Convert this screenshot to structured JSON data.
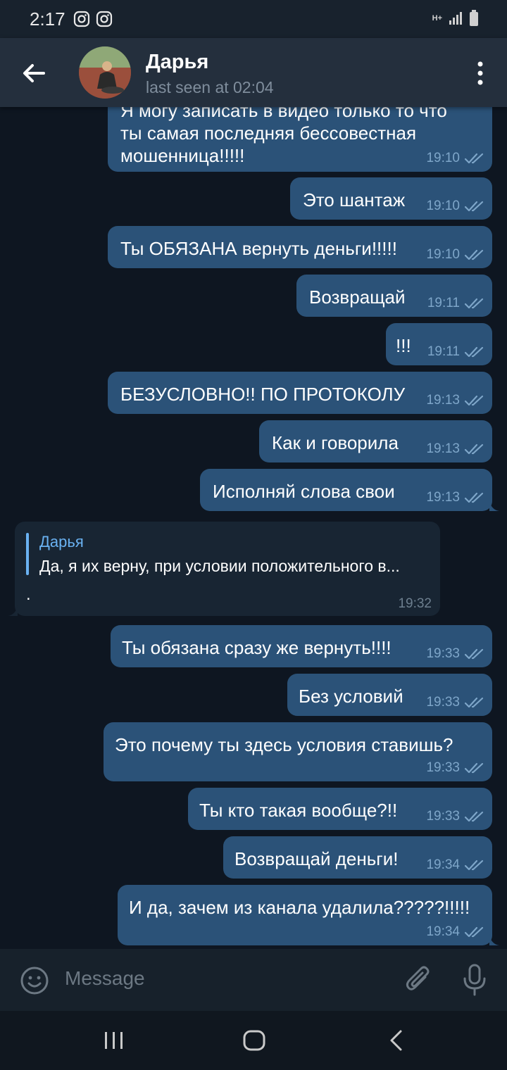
{
  "status_bar": {
    "time": "2:17",
    "network": "H+"
  },
  "header": {
    "name": "Дарья",
    "status": "last seen at 02:04"
  },
  "messages": [
    {
      "lines": [
        "Я могу записать в видео только то что",
        "ты самая последняя бессовестная",
        "мошенница!!!!!"
      ],
      "time": "19:10"
    },
    {
      "text": "Это шантаж",
      "time": "19:10"
    },
    {
      "text": "Ты ОБЯЗАНА вернуть деньги!!!!!",
      "time": "19:10"
    },
    {
      "text": "Возвращай",
      "time": "19:11"
    },
    {
      "text": "!!!",
      "time": "19:11"
    },
    {
      "text": "БЕЗУСЛОВНО!! ПО ПРОТОКОЛУ",
      "time": "19:13"
    },
    {
      "text": "Как и говорила",
      "time": "19:13"
    },
    {
      "text": "Исполняй слова свои",
      "time": "19:13"
    },
    {
      "reply_name": "Дарья",
      "reply_text": "Да, я их верну, при условии положительного в...",
      "text": ".",
      "time": "19:32"
    },
    {
      "text": "Ты обязана сразу же вернуть!!!!",
      "time": "19:33"
    },
    {
      "text": "Без условий",
      "time": "19:33"
    },
    {
      "text": "Это почему ты здесь условия ставишь?",
      "time": "19:33"
    },
    {
      "text": "Ты кто такая вообще?!!",
      "time": "19:33"
    },
    {
      "text": "Возвращай деньги!",
      "time": "19:34"
    },
    {
      "text": "И да, зачем из канала удалила?????!!!!!",
      "time": "19:34"
    }
  ],
  "input": {
    "placeholder": "Message"
  },
  "colors": {
    "outgoing_bubble": "#2b5278",
    "incoming_bubble": "#182533",
    "background": "#0e1621",
    "accent": "#6ab2f2"
  }
}
